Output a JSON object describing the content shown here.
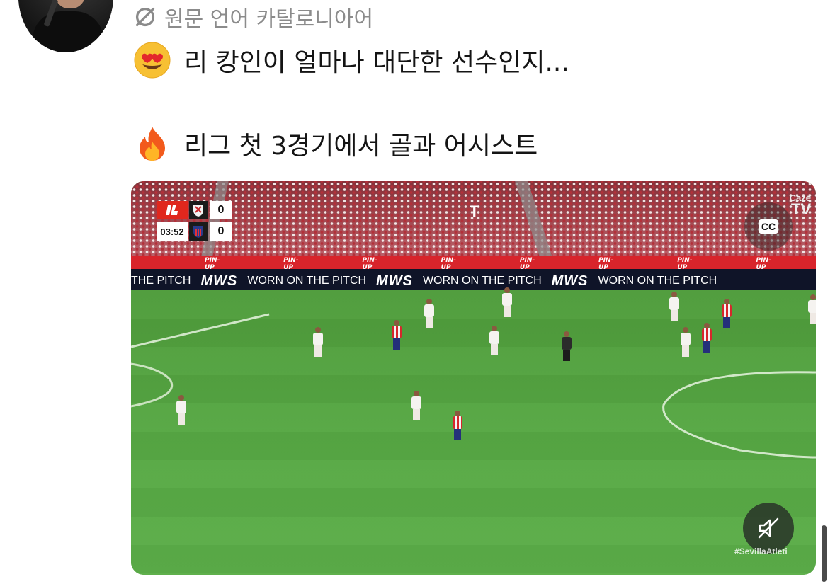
{
  "post": {
    "translate_label": "원문 언어 카탈로니아어",
    "line1_emoji": "heart-eyes-emoji",
    "line1": "리 캉인이 얼마나 대단한 선수인지...",
    "line2_emoji": "fire-emoji",
    "line2": "리그 첫 3경기에서 골과 어시스트"
  },
  "video": {
    "scoreboard": {
      "time": "03:52",
      "home_score": "0",
      "away_score": "0"
    },
    "broadcaster_watermark": "T",
    "channel_logo_line1": "Cazé",
    "channel_logo_line2": "TV",
    "cc_label": "CC",
    "hashtag": "#SevillaAtleti",
    "ad_board_small": [
      "PIN-UP",
      "PIN-UP",
      "PIN-UP",
      "PIN-UP",
      "PIN-UP",
      "PIN-UP",
      "PIN-UP",
      "PIN-UP"
    ],
    "ad_line": [
      "THE PITCH",
      "MWS",
      "WORN ON THE PITCH",
      "MWS",
      "WORN ON THE PITCH",
      "MWS",
      "WORN ON THE PITCH"
    ],
    "muted": true
  },
  "colors": {
    "pitch_green": "#57a844",
    "board_red": "#d8242b",
    "text_gray": "#8b8b8b"
  }
}
